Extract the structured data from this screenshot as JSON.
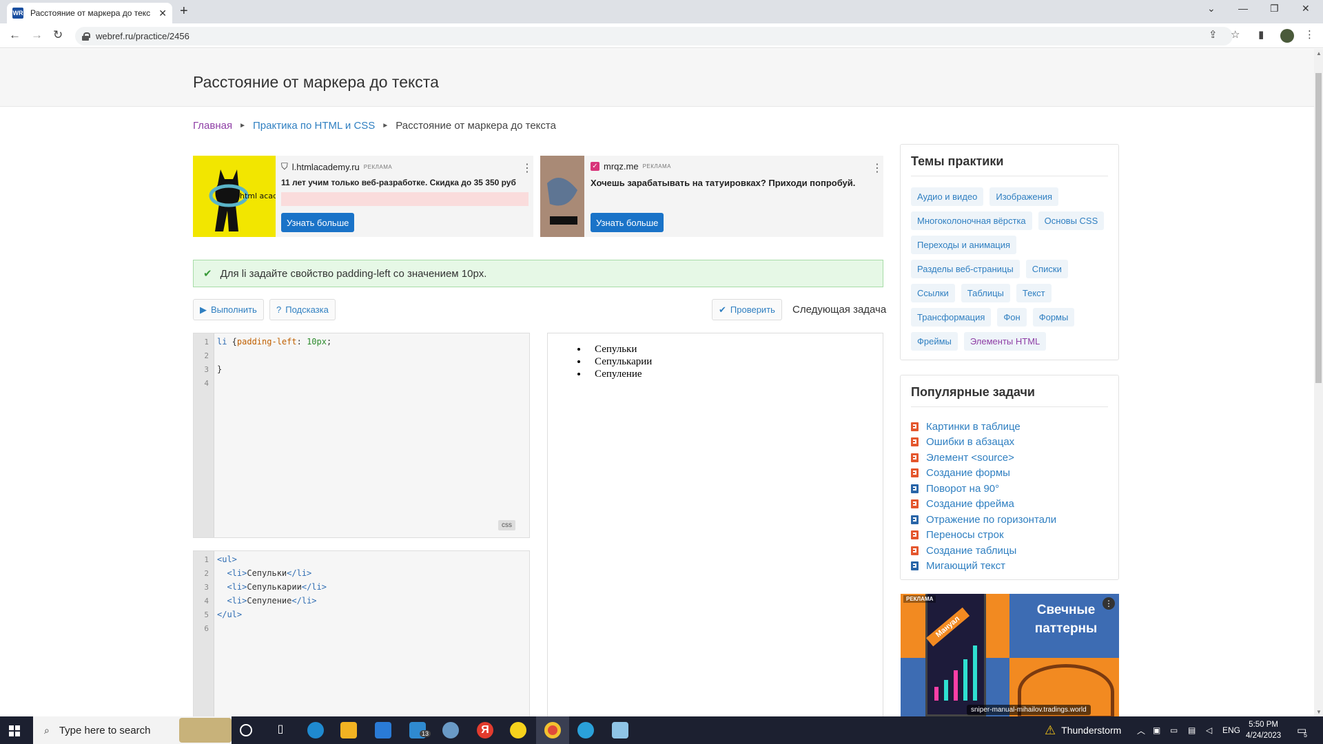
{
  "browser": {
    "tab_title": "Расстояние от маркера до текс",
    "favicon": "WR",
    "url": "webref.ru/practice/2456"
  },
  "page": {
    "title": "Расстояние от маркера до текста",
    "breadcrumbs": [
      "Главная",
      "Практика по HTML и CSS",
      "Расстояние от маркера до текста"
    ]
  },
  "ads": [
    {
      "domain": "l.htmlacademy.ru",
      "label": "РЕКЛАМА",
      "text": "11 лет учим только веб-разработке. Скидка до 35 350 руб",
      "cta": "Узнать больше",
      "logo": "html academy"
    },
    {
      "domain": "mrqz.me",
      "label": "РЕКЛАМА",
      "text": "Хочешь зарабатывать на татуировках? Приходи попробуй.",
      "cta": "Узнать больше"
    }
  ],
  "task": {
    "text": "Для li задайте свойство padding-left со значением 10px."
  },
  "toolbar": {
    "run": "Выполнить",
    "hint": "Подсказка",
    "check": "Проверить",
    "next": "Следующая задача"
  },
  "css_editor": {
    "badge": "css",
    "lines": [
      {
        "n": "1",
        "sel": "li",
        "brace": " {",
        "prop": "padding-left",
        "colon": ": ",
        "val": "10px",
        "end": ";"
      },
      {
        "n": "2"
      },
      {
        "n": "3",
        "plain": "}"
      },
      {
        "n": "4"
      }
    ]
  },
  "html_editor": {
    "lines": [
      {
        "n": "1",
        "code": "<ul>"
      },
      {
        "n": "2",
        "code": "  <li>Сепульки</li>"
      },
      {
        "n": "3",
        "code": "  <li>Сепулькарии</li>"
      },
      {
        "n": "4",
        "code": "  <li>Сепуление</li>"
      },
      {
        "n": "5",
        "code": "</ul>"
      },
      {
        "n": "6",
        "code": ""
      }
    ]
  },
  "preview": {
    "items": [
      "Сепульки",
      "Сепулькарии",
      "Сепуление"
    ]
  },
  "sidebar": {
    "topics_title": "Темы практики",
    "topics": [
      "Аудио и видео",
      "Изображения",
      "Многоколоночная вёрстка",
      "Основы CSS",
      "Переходы и анимация",
      "Разделы веб-страницы",
      "Списки",
      "Ссылки",
      "Таблицы",
      "Текст",
      "Трансформация",
      "Фон",
      "Формы",
      "Фреймы",
      "Элементы HTML"
    ],
    "popular_title": "Популярные задачи",
    "popular": [
      {
        "label": "Картинки в таблице",
        "icon": "html5-icon"
      },
      {
        "label": "Ошибки в абзацах",
        "icon": "html5-icon"
      },
      {
        "label": "Элемент <source>",
        "icon": "html5-icon"
      },
      {
        "label": "Создание формы",
        "icon": "html5-icon"
      },
      {
        "label": "Поворот на 90°",
        "icon": "css3-icon"
      },
      {
        "label": "Создание фрейма",
        "icon": "html5-icon"
      },
      {
        "label": "Отражение по горизонтали",
        "icon": "css3-icon"
      },
      {
        "label": "Переносы строк",
        "icon": "html5-icon"
      },
      {
        "label": "Создание таблицы",
        "icon": "html5-icon"
      },
      {
        "label": "Мигающий текст",
        "icon": "css3-icon"
      }
    ]
  },
  "side_ad": {
    "label": "РЕКЛАМА",
    "title": "Свечные паттерны",
    "ribbon": "Мануал",
    "footer": "sniper-manual-mihailov.tradings.world"
  },
  "taskbar": {
    "search_placeholder": "Type here to search",
    "weather": "Thunderstorm",
    "lang": "ENG",
    "time": "5:50 PM",
    "date": "4/24/2023",
    "mail_badge": "13",
    "notif_count": "5"
  }
}
